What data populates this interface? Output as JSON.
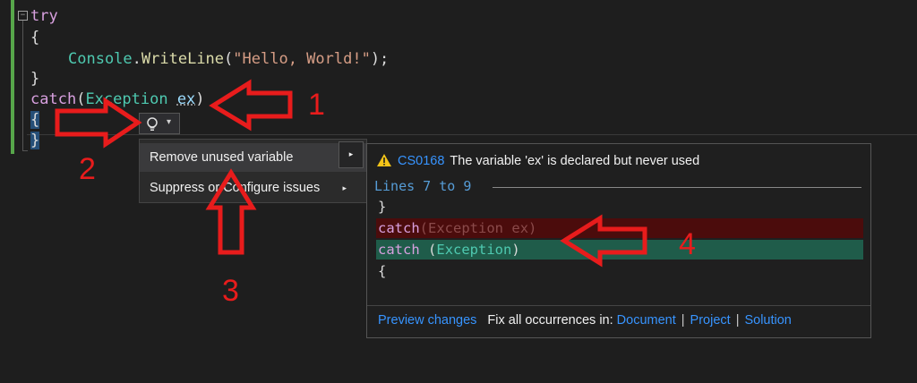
{
  "editor": {
    "lines": [
      {
        "kw": "try"
      },
      {
        "text": "{"
      },
      {
        "obj": "Console",
        "dot": ".",
        "method": "WriteLine",
        "open": "(",
        "str": "\"Hello, World!\"",
        "close": ");"
      },
      {
        "text": "}"
      },
      {
        "kw": "catch",
        "open": "(",
        "type": "Exception",
        "space": " ",
        "var": "ex",
        "close": ")"
      },
      {
        "text": "{"
      },
      {
        "text": "}"
      }
    ]
  },
  "lightbulb": {
    "icon": "lightbulb-icon",
    "arrow": "▾"
  },
  "quick_actions_menu": {
    "items": [
      {
        "label": "Remove unused variable",
        "sub": "▸"
      },
      {
        "label": "Suppress or Configure issues",
        "sub": "▸"
      }
    ],
    "submenu_arrow": "▸"
  },
  "preview": {
    "warning_icon": "warning-icon",
    "code": "CS0168",
    "message": "The variable 'ex' is declared but never used",
    "lines_label": "Lines 7 to 9",
    "diff": {
      "context_top": "}",
      "removed": {
        "kw": "catch",
        "open": "(",
        "type": "Exception",
        "space": " ",
        "var": "ex",
        "close": ")"
      },
      "added": {
        "kw": "catch",
        "space": " ",
        "open": "(",
        "type": "Exception",
        "close": ")"
      },
      "context_bottom": "{"
    },
    "footer": {
      "preview_link": "Preview changes",
      "fix_all_label": "Fix all occurrences in:",
      "document_link": "Document",
      "project_link": "Project",
      "solution_link": "Solution",
      "separator": "|"
    }
  },
  "annotations": {
    "labels": [
      "1",
      "2",
      "3",
      "4"
    ],
    "color": "#e81c1c"
  }
}
